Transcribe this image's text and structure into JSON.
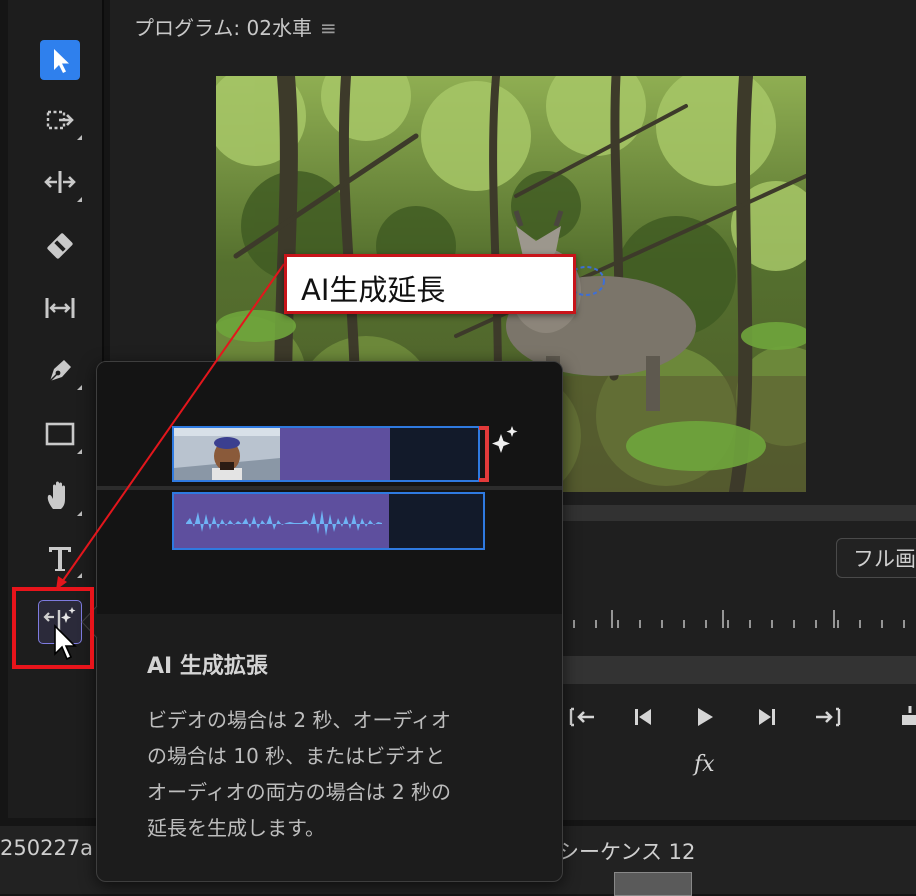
{
  "monitor": {
    "title": "プログラム: 02水車",
    "menu_icon": "hamburger-icon",
    "fit_select": "フル画"
  },
  "toolbar": {
    "tools": [
      {
        "name": "selection-tool",
        "icon": "arrow-pointer-icon",
        "selected": true
      },
      {
        "name": "track-select-tool",
        "icon": "track-select-forward-icon"
      },
      {
        "name": "ripple-edit-tool",
        "icon": "ripple-edit-icon"
      },
      {
        "name": "razor-tool",
        "icon": "razor-icon"
      },
      {
        "name": "slip-tool",
        "icon": "slip-icon"
      },
      {
        "name": "pen-tool",
        "icon": "pen-icon"
      },
      {
        "name": "rectangle-tool",
        "icon": "rectangle-icon"
      },
      {
        "name": "hand-tool",
        "icon": "hand-icon"
      },
      {
        "name": "type-tool",
        "icon": "type-icon"
      },
      {
        "name": "generative-extend-tool",
        "icon": "generative-extend-icon",
        "highlighted": true
      }
    ]
  },
  "callout": {
    "text": "AI生成延長"
  },
  "tooltip": {
    "title": "AI 生成拡張",
    "description_lines": [
      "ビデオの場合は 2 秒、オーディオ",
      "の場合は 10 秒、またはビデオと",
      "オーディオの両方の場合は 2 秒の",
      "延長を生成します。"
    ]
  },
  "controls": {
    "fx_label": "fx",
    "icons": [
      "go-to-in-icon",
      "step-back-icon",
      "play-icon",
      "step-forward-icon",
      "go-to-out-icon",
      "lift-icon"
    ]
  },
  "bottom": {
    "left_text": "250227a",
    "sequence_text": "シーケンス 12"
  },
  "colors": {
    "accent_blue": "#2f80ed",
    "highlight_red": "#e8141b",
    "clip_purple": "#5e4f9e",
    "clip_border": "#2f7ae0"
  }
}
